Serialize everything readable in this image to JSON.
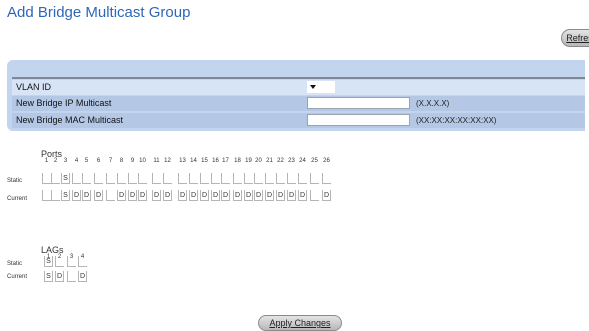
{
  "page": {
    "title": "Add Bridge Multicast Group"
  },
  "buttons": {
    "refresh": "Refresh",
    "apply": "Apply Changes"
  },
  "form": {
    "vlan_label": "VLAN ID",
    "ip_label": "New Bridge IP Multicast",
    "ip_hint": "(X.X.X.X)",
    "ip_value": "",
    "mac_label": "New Bridge MAC Multicast",
    "mac_hint": "(XX:XX:XX:XX:XX:XX)",
    "mac_value": ""
  },
  "ports": {
    "title": "Ports",
    "static_label": "Static",
    "current_label": "Current",
    "numbers": [
      "1",
      "2",
      "3",
      "4",
      "5",
      "6",
      "7",
      "8",
      "9",
      "10",
      "11",
      "12",
      "13",
      "14",
      "15",
      "16",
      "17",
      "18",
      "19",
      "20",
      "21",
      "22",
      "23",
      "24",
      "25",
      "26"
    ],
    "static": [
      "",
      "",
      "S",
      "",
      "",
      "",
      "",
      "",
      "",
      "",
      "",
      "",
      "",
      "",
      "",
      "",
      "",
      "",
      "",
      "",
      "",
      "",
      "",
      "",
      "",
      ""
    ],
    "current": [
      "",
      "",
      "S",
      "D",
      "D",
      "D",
      "",
      "D",
      "D",
      "D",
      "D",
      "D",
      "D",
      "D",
      "D",
      "D",
      "D",
      "D",
      "D",
      "D",
      "D",
      "D",
      "D",
      "D",
      "",
      "D"
    ]
  },
  "lags": {
    "title": "LAGs",
    "static_label": "Static",
    "current_label": "Current",
    "numbers": [
      "1",
      "2",
      "3",
      "4"
    ],
    "static": [
      "S",
      "",
      "",
      ""
    ],
    "current": [
      "S",
      "D",
      "",
      "D"
    ]
  }
}
